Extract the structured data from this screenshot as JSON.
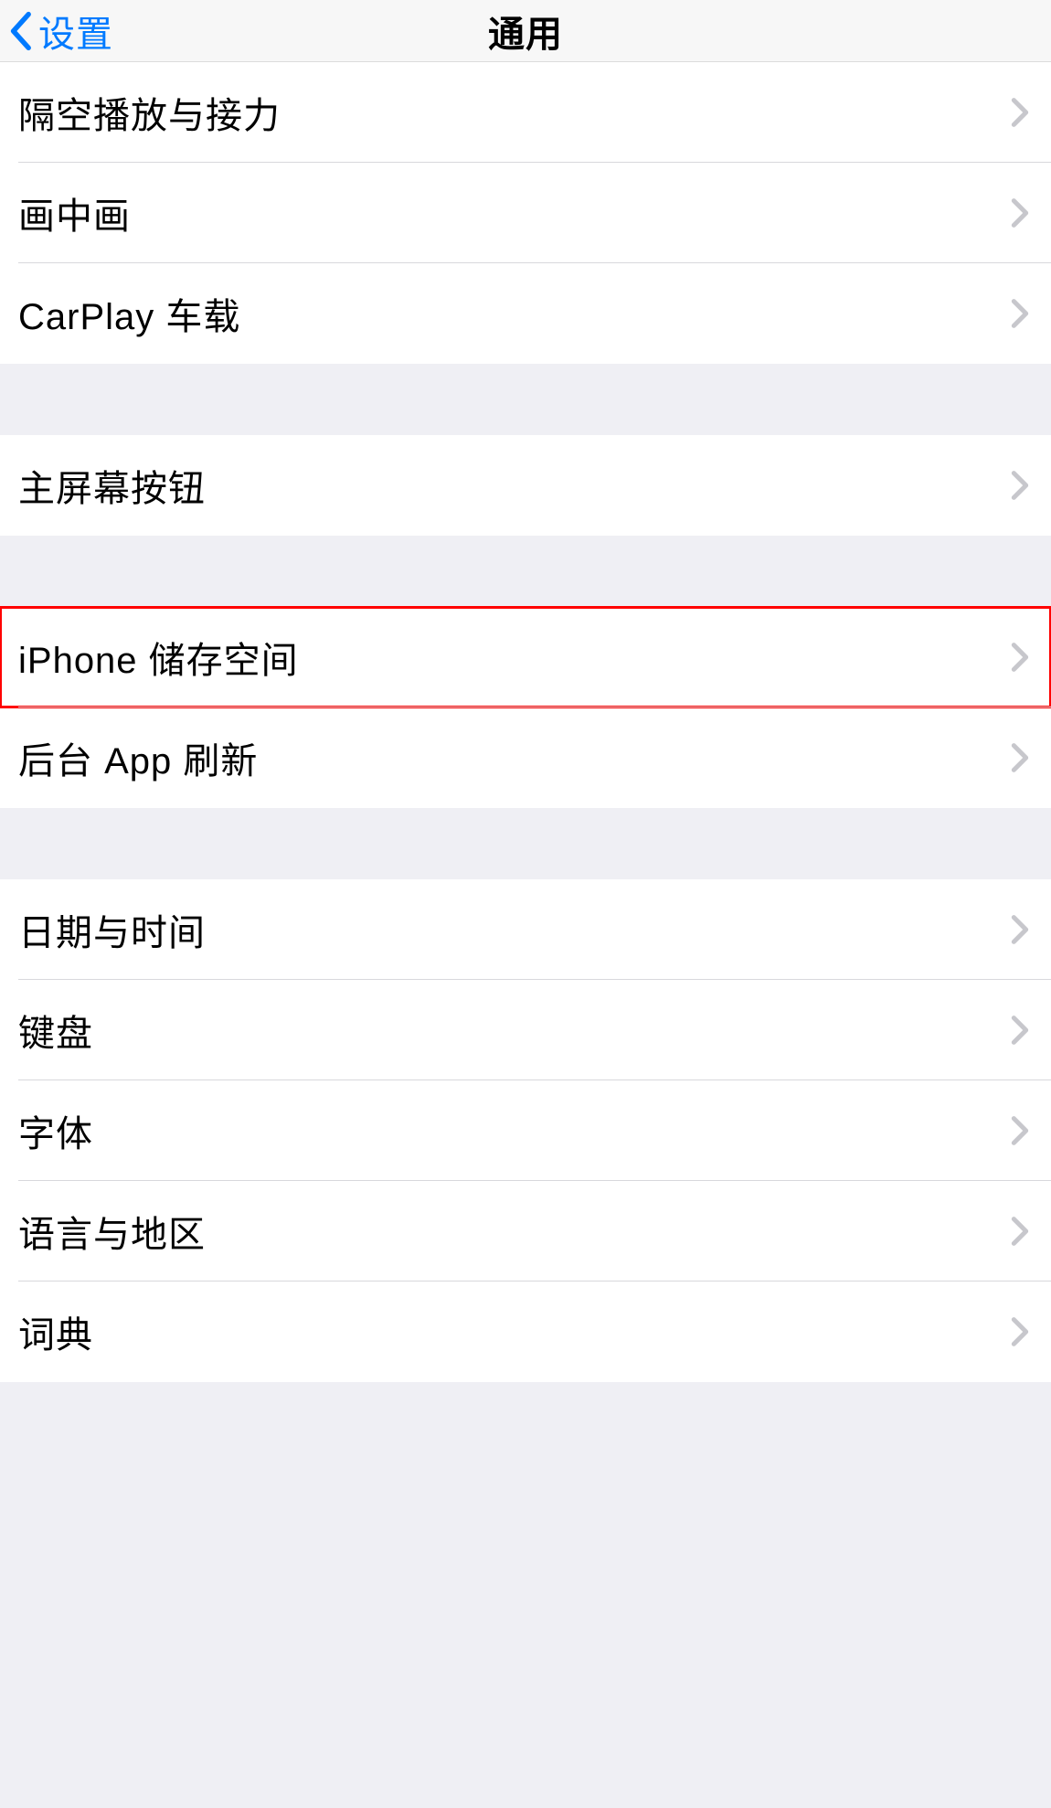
{
  "navbar": {
    "back_label": "设置",
    "title": "通用"
  },
  "colors": {
    "accent": "#007aff",
    "highlight": "#ff0000",
    "chevron": "#c7c7cc"
  },
  "groups": [
    {
      "rows": [
        {
          "id": "airplay-handoff",
          "label": "隔空播放与接力",
          "highlighted": false
        },
        {
          "id": "pip",
          "label": "画中画",
          "highlighted": false
        },
        {
          "id": "carplay",
          "label": "CarPlay 车载",
          "highlighted": false
        }
      ]
    },
    {
      "rows": [
        {
          "id": "home-button",
          "label": "主屏幕按钮",
          "highlighted": false
        }
      ]
    },
    {
      "rows": [
        {
          "id": "iphone-storage",
          "label": "iPhone 储存空间",
          "highlighted": true
        },
        {
          "id": "background-app-refresh",
          "label": "后台 App 刷新",
          "highlighted": false
        }
      ]
    },
    {
      "rows": [
        {
          "id": "date-time",
          "label": "日期与时间",
          "highlighted": false
        },
        {
          "id": "keyboard",
          "label": "键盘",
          "highlighted": false
        },
        {
          "id": "fonts",
          "label": "字体",
          "highlighted": false
        },
        {
          "id": "language-region",
          "label": "语言与地区",
          "highlighted": false
        },
        {
          "id": "dictionary",
          "label": "词典",
          "highlighted": false
        }
      ]
    }
  ]
}
